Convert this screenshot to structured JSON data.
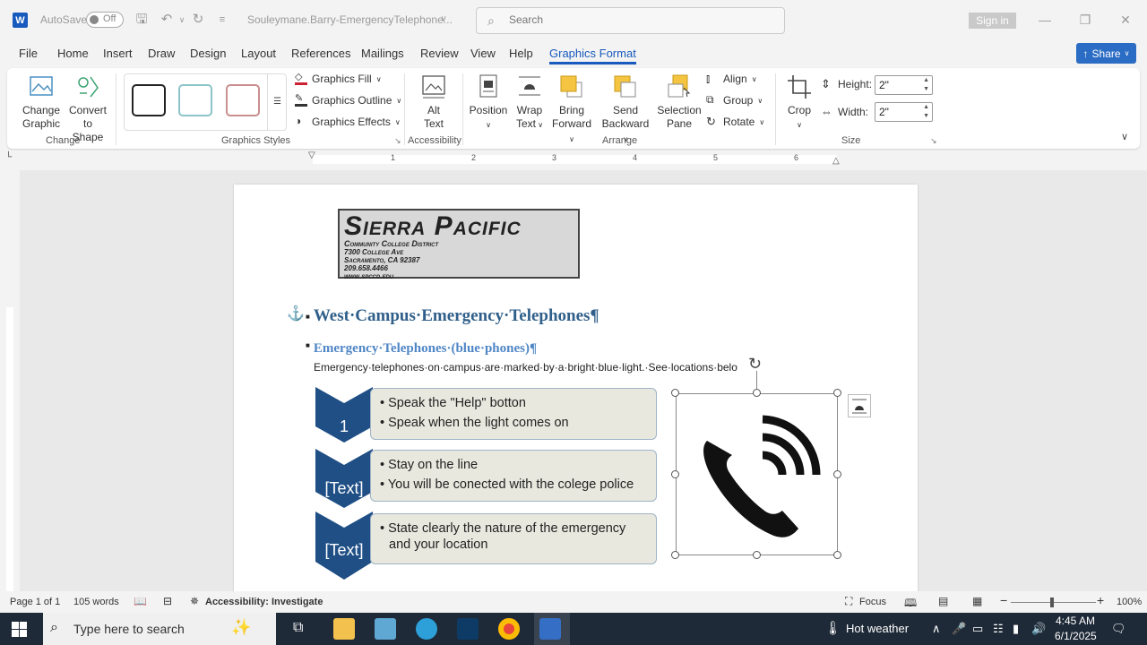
{
  "titlebar": {
    "app_icon": "W",
    "autosave_label": "AutoSave",
    "autosave_state": "Off",
    "document_title": "Souleymane.Barry-EmergencyTelephone...",
    "search_placeholder": "Search",
    "signin_label": "Sign in"
  },
  "menu": {
    "tabs": [
      "File",
      "Home",
      "Insert",
      "Draw",
      "Design",
      "Layout",
      "References",
      "Mailings",
      "Review",
      "View",
      "Help",
      "Graphics Format"
    ],
    "active_tab": "Graphics Format",
    "share_label": "Share"
  },
  "ribbon": {
    "change_graphic": "Change Graphic",
    "change_graphic_l1": "Change",
    "change_graphic_l2": "Graphic",
    "convert_l1": "Convert",
    "convert_l2": "to Shape",
    "group_change": "Change",
    "graphics_fill": "Graphics Fill",
    "graphics_outline": "Graphics Outline",
    "graphics_effects": "Graphics Effects",
    "group_styles": "Graphics Styles",
    "alt_l1": "Alt",
    "alt_l2": "Text",
    "group_accessibility": "Accessibility",
    "position": "Position",
    "wrap_l1": "Wrap",
    "wrap_l2": "Text",
    "bring_l1": "Bring",
    "bring_l2": "Forward",
    "send_l1": "Send",
    "send_l2": "Backward",
    "selection_l1": "Selection",
    "selection_l2": "Pane",
    "align": "Align",
    "group": "Group",
    "rotate": "Rotate",
    "group_arrange": "Arrange",
    "crop": "Crop",
    "height_label": "Height:",
    "height_value": "2\"",
    "width_label": "Width:",
    "width_value": "2\"",
    "group_size": "Size"
  },
  "ruler": {
    "numbers": [
      "1",
      "2",
      "3",
      "4",
      "5",
      "6"
    ]
  },
  "document": {
    "logo_title": "Sierra Pacific",
    "logo_sub": "Community College District",
    "logo_addr1": "7300 College Ave",
    "logo_addr2": "Sacramento, CA 92387",
    "logo_phone": "209.658.4466",
    "logo_web": "www.spccd.edu",
    "heading1": "West·Campus·Emergency·Telephones¶",
    "heading2": "Emergency·Telephones·(blue·phones)¶",
    "body": "Emergency·telephones·on·campus·are·marked·by·a·bright·blue·light.·See·locations·belo",
    "steps": [
      {
        "number": "1",
        "items": [
          "Speak the \"Help\" botton",
          "Speak when the light comes on"
        ]
      },
      {
        "number": "[Text]",
        "items": [
          "Stay on the line",
          "You will be conected with the colege police"
        ]
      },
      {
        "number": "[Text]",
        "items": [
          "State clearly the nature of the emergency",
          "and your location"
        ]
      }
    ]
  },
  "statusbar": {
    "page": "Page 1 of 1",
    "words": "105 words",
    "accessibility": "Accessibility: Investigate",
    "focus": "Focus",
    "zoom": "100%"
  },
  "taskbar": {
    "search_placeholder": "Type here to search",
    "weather": "Hot weather",
    "time": "4:45 AM",
    "date": "6/1/2025"
  },
  "colors": {
    "word_blue": "#185abd",
    "chevron_blue": "#1f4f85",
    "heading_blue": "#2f5f8a",
    "taskbar": "#1f2a38"
  }
}
